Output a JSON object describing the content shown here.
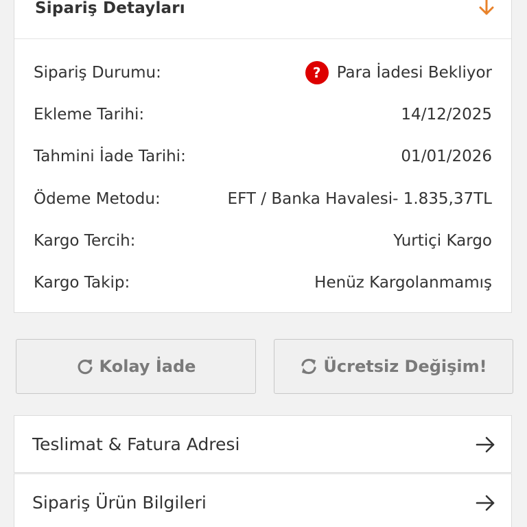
{
  "order_details": {
    "title": "Sipariş Detayları",
    "toggle_icon": "arrow-down-icon",
    "rows": [
      {
        "label": "Sipariş Durumu:",
        "value": "Para İadesi Bekliyor",
        "badge": "?"
      },
      {
        "label": "Ekleme Tarihi:",
        "value": "14/12/2025"
      },
      {
        "label": "Tahmini İade Tarihi:",
        "value": "01/01/2026"
      },
      {
        "label": "Ödeme Metodu:",
        "value": "EFT / Banka Havalesi- 1.835,37TL"
      },
      {
        "label": "Kargo Tercih:",
        "value": "Yurtiçi Kargo"
      },
      {
        "label": "Kargo Takip:",
        "value": "Henüz Kargolanmamış"
      }
    ]
  },
  "actions": {
    "easy_return": {
      "label": "Kolay İade",
      "icon": "refresh-icon"
    },
    "free_exchange": {
      "label": "Ücretsiz Değişim!",
      "icon": "sync-icon"
    }
  },
  "nav": {
    "delivery_address": {
      "label": "Teslimat & Fatura Adresi",
      "icon": "arrow-right-icon"
    },
    "product_info": {
      "label": "Sipariş Ürün Bilgileri",
      "icon": "arrow-right-icon"
    }
  },
  "colors": {
    "accent_orange": "#e8822a",
    "status_red": "#dd0000",
    "button_text": "#7a7a7a",
    "text": "#333333"
  }
}
